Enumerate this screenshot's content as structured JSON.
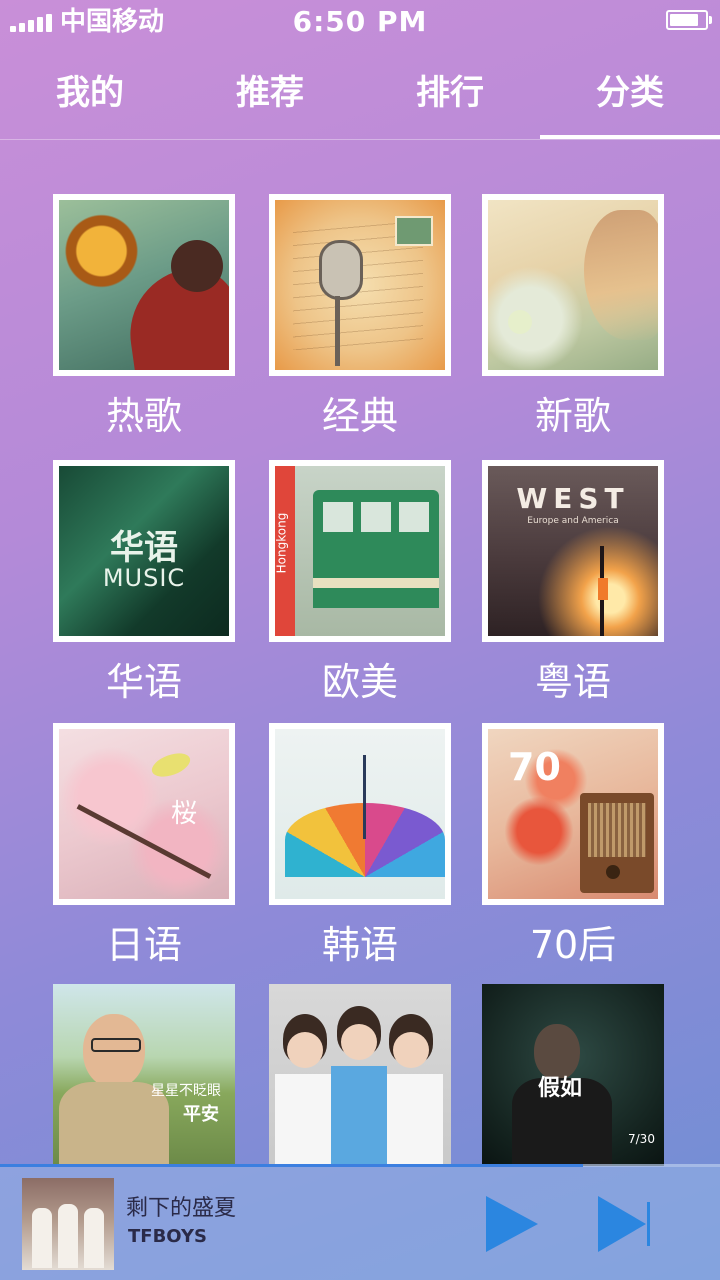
{
  "status_bar": {
    "carrier": "中国移动",
    "time": "6:50 PM",
    "battery_level": 0.85
  },
  "tabs": [
    {
      "label": "我的",
      "active": false
    },
    {
      "label": "推荐",
      "active": false
    },
    {
      "label": "排行",
      "active": false
    },
    {
      "label": "分类",
      "active": true
    }
  ],
  "categories": [
    {
      "label": "热歌",
      "cover": "orange-ball-photo"
    },
    {
      "label": "经典",
      "cover": "vintage-microphone-photo"
    },
    {
      "label": "新歌",
      "cover": "sunlit-girl-photo"
    },
    {
      "label": "华语",
      "cover": "music-green-cover",
      "cover_text": "华语",
      "cover_subtext": "MUSIC"
    },
    {
      "label": "欧美",
      "cover": "hongkong-tram-photo",
      "cover_text": "Hongkong"
    },
    {
      "label": "粤语",
      "cover": "west-street-photo",
      "cover_text": "WEST",
      "cover_subtext": "Europe and America"
    },
    {
      "label": "日语",
      "cover": "cherry-blossom-photo",
      "cover_text": "桜"
    },
    {
      "label": "韩语",
      "cover": "umbrella-photo"
    },
    {
      "label": "70后",
      "cover": "retro-radio-photo",
      "cover_text": "70"
    }
  ],
  "albums": [
    {
      "cover": "man-glasses-photo",
      "cover_text": "星星不眨眼",
      "cover_subtext": "平安"
    },
    {
      "cover": "three-boys-photo"
    },
    {
      "cover": "dark-album-photo",
      "cover_text": "假如",
      "cover_subtext": "7/30"
    }
  ],
  "player": {
    "title": "剩下的盛夏",
    "artist": "TFBOYS",
    "progress": 0.81,
    "play_icon": "play-icon",
    "next_icon": "skip-next-icon"
  },
  "colors": {
    "accent": "#2b86e0",
    "text": "#ffffff",
    "player_text": "#2a2a48"
  }
}
